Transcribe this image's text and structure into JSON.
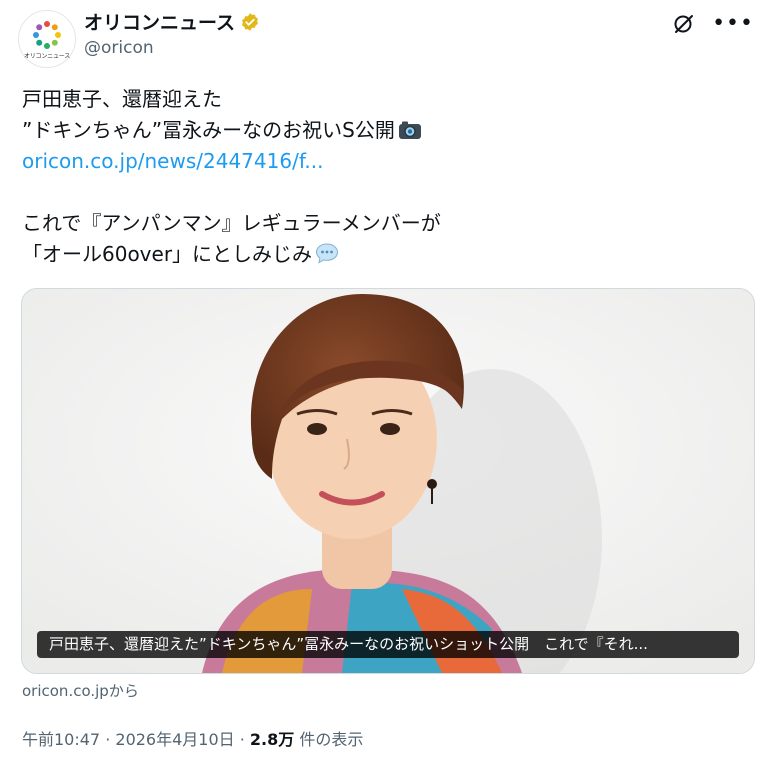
{
  "account": {
    "display_name": "オリコンニュース",
    "handle": "@oricon",
    "avatar_text": "オリコンニュース",
    "verified_color": "#e2b719"
  },
  "tweet": {
    "line1": "戸田恵子、還暦迎えた",
    "line2": "”ドキンちゃん”冨永みーなのお祝いS公開",
    "link": "oricon.co.jp/news/2447416/f...",
    "line3": "これで『アンパンマン』レギュラーメンバーが",
    "line4": "「オール60over」にとしみじみ",
    "emoji_camera": "camera-icon",
    "emoji_speech": "speech-bubble-icon"
  },
  "card": {
    "caption": "戸田恵子、還暦迎えた”ドキンちゃん”冨永みーなのお祝いショット公開　これで『それ...",
    "source": "oricon.co.jpから"
  },
  "meta": {
    "time": "午前10:47",
    "sep1": " · ",
    "date": "2026年4月10日",
    "sep2": " · ",
    "views": "2.8万",
    "views_label": " 件の表示"
  },
  "colors": {
    "link": "#1d9bf0",
    "secondary_text": "#536471"
  }
}
